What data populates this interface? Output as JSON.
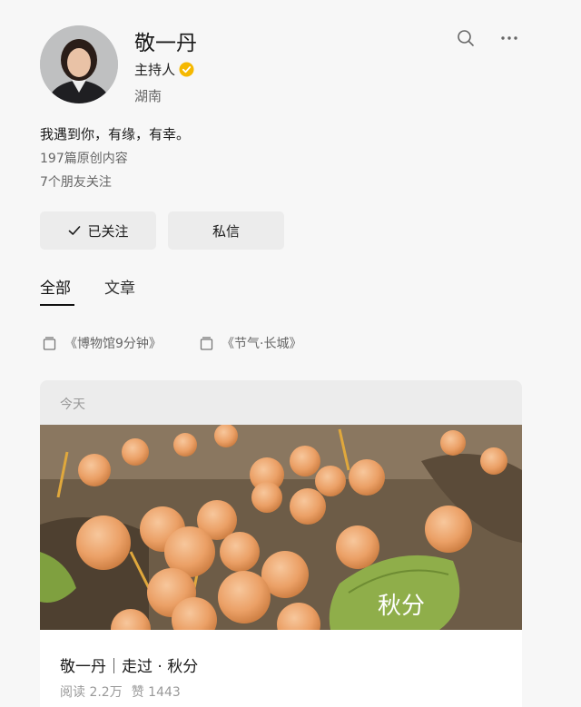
{
  "profile": {
    "name": "敬一丹",
    "role": "主持人",
    "region": "湖南",
    "bio": "我遇到你，有缘，有幸。",
    "original_count": "197篇原创内容",
    "friends_following": "7个朋友关注"
  },
  "header": {
    "search_icon": "search-icon",
    "more_icon": "more-icon"
  },
  "actions": {
    "follow_label": "已关注",
    "message_label": "私信"
  },
  "tabs": [
    {
      "label": "全部",
      "active": true
    },
    {
      "label": "文章",
      "active": false
    }
  ],
  "albums": [
    {
      "label": "《博物馆9分钟》"
    },
    {
      "label": "《节气·长城》"
    }
  ],
  "feed": {
    "date_label": "今天",
    "image_caption": "秋分",
    "title": "敬一丹｜走过 · 秋分",
    "reads": "阅读 2.2万",
    "likes": "赞 1443"
  },
  "colors": {
    "verified_badge": "#f5b800",
    "background": "#f7f7f7",
    "button_bg": "#ececec"
  }
}
